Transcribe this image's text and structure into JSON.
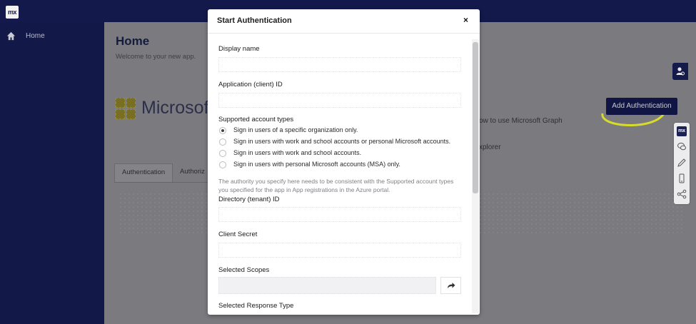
{
  "app": {
    "logo_text": "mx"
  },
  "sidebar": {
    "items": [
      {
        "label": "Home",
        "icon": "home-icon"
      }
    ]
  },
  "page": {
    "title": "Home",
    "subtitle": "Welcome to your new app.",
    "brand_text": "Microsof",
    "graph_text": "ow to use Microsoft Graph",
    "explorer_text": "xplorer",
    "add_auth_label": "Add Authentication",
    "tabs": [
      {
        "label": "Authentication"
      },
      {
        "label": "Authoriz"
      }
    ]
  },
  "right_tools": {
    "user_icon": "user-settings-icon",
    "panel": [
      "mx-icon",
      "chat-icon",
      "pencil-icon",
      "mobile-icon",
      "share-icon"
    ],
    "panel_mx_text": "mx"
  },
  "modal": {
    "title": "Start Authentication",
    "close_label": "×",
    "fields": {
      "display_name": {
        "label": "Display name",
        "value": ""
      },
      "client_id": {
        "label": "Application (client) ID",
        "value": ""
      },
      "account_types": {
        "label": "Supported account types",
        "options": [
          "Sign in users of a specific organization only.",
          "Sign in users with work and school accounts or personal Microsoft accounts.",
          "Sign in users with work and school accounts.",
          "Sign in users with personal Microsoft accounts (MSA) only."
        ],
        "selected_index": 0,
        "help": "The authority you specify here needs to be consistent with the Supported account types you specified for the app in App registrations in the Azure portal."
      },
      "tenant_id": {
        "label": "Directory (tenant) ID",
        "value": ""
      },
      "client_secret": {
        "label": "Client Secret",
        "value": ""
      },
      "scopes": {
        "label": "Selected Scopes",
        "value": ""
      },
      "response_type": {
        "label": "Selected Response Type"
      }
    }
  },
  "colors": {
    "nav": "#13194a",
    "sidebar": "#121948",
    "accent_highlight": "#d9db2a",
    "modal_bg": "#ffffff"
  }
}
